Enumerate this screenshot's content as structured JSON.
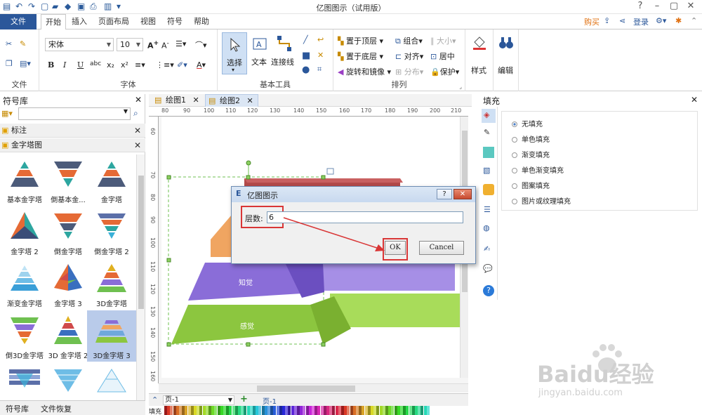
{
  "window": {
    "title": "亿图图示（试用版）"
  },
  "menu": {
    "file": "文件",
    "tabs": [
      "开始",
      "插入",
      "页面布局",
      "视图",
      "符号",
      "帮助"
    ],
    "active_tab": "开始",
    "right": {
      "buy": "购买",
      "login": "登录"
    }
  },
  "ribbon": {
    "file_group": {
      "label": "文件"
    },
    "font_group": {
      "label": "字体",
      "font_name": "宋体",
      "font_size": "10"
    },
    "tools_group": {
      "label": "基本工具",
      "select": "选择",
      "text": "文本",
      "connector": "连接线"
    },
    "arrange_group": {
      "label": "排列",
      "bring_front": "置于顶层",
      "send_back": "置于底层",
      "rotate_mirror": "旋转和镜像",
      "group": "组合",
      "align": "对齐",
      "distribute": "分布",
      "size": "大小",
      "center": "居中",
      "protect": "保护"
    },
    "style": "样式",
    "edit": "编辑"
  },
  "left_panel": {
    "title": "符号库",
    "search_placeholder": "",
    "categories": [
      "标注",
      "金字塔图"
    ],
    "shapes": [
      {
        "label": "基本金字塔"
      },
      {
        "label": "倒基本金..."
      },
      {
        "label": "金字塔"
      },
      {
        "label": "金字塔 2"
      },
      {
        "label": "倒金字塔"
      },
      {
        "label": "倒金字塔 2"
      },
      {
        "label": "渐变金字塔"
      },
      {
        "label": "金字塔 3"
      },
      {
        "label": "3D金字塔"
      },
      {
        "label": "倒3D金字塔"
      },
      {
        "label": "3D 金字塔 2"
      },
      {
        "label": "3D金字塔 3"
      }
    ],
    "bottom_tabs": [
      "符号库",
      "文件恢复"
    ]
  },
  "documents": {
    "tabs": [
      "绘图1",
      "绘图2"
    ],
    "active": "绘图2"
  },
  "ruler": {
    "h": [
      "80",
      "90",
      "100",
      "110",
      "120",
      "130",
      "140",
      "150",
      "160",
      "170",
      "180",
      "190",
      "200",
      "210"
    ],
    "v": [
      "60",
      "70",
      "80",
      "90",
      "100",
      "110",
      "120",
      "130",
      "140",
      "150",
      "160"
    ]
  },
  "diagram": {
    "level_labels": [
      "知觉",
      "感觉"
    ],
    "colors": {
      "top": "#b34a4a",
      "orange": "#f0a561",
      "purple": "#8a6dd8",
      "green": "#8cc63f"
    }
  },
  "dialog": {
    "title": "亿图图示",
    "field_label": "层数:",
    "field_value": "6",
    "ok": "OK",
    "cancel": "Cancel",
    "highlight_color": "#d93636"
  },
  "fill_panel": {
    "title": "填充",
    "options": [
      "无填充",
      "单色填充",
      "渐变填充",
      "单色渐变填充",
      "图案填充",
      "图片或纹理填充"
    ],
    "selected": 0
  },
  "status": {
    "page_selector": "页-1",
    "page_tab": "页-1",
    "fill_label": "填充"
  },
  "watermark": {
    "brand": "Baidu经验",
    "url": "jingyan.baidu.com"
  }
}
